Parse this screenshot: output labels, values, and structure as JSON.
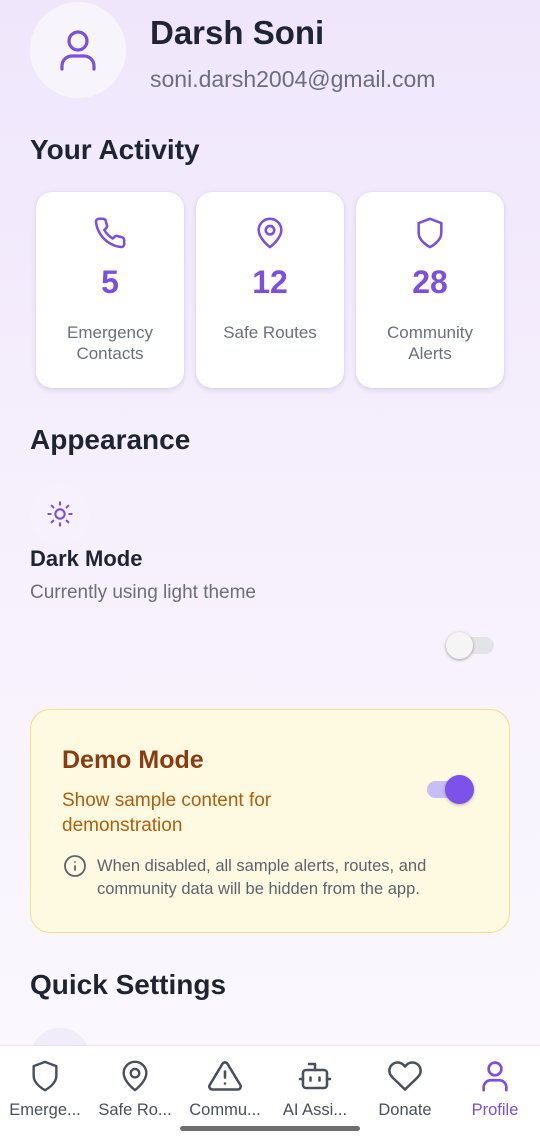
{
  "profile": {
    "name": "Darsh Soni",
    "email": "soni.darsh2004@gmail.com",
    "avatar_icon": "user-icon"
  },
  "activity": {
    "title": "Your Activity",
    "stats": [
      {
        "value": "5",
        "label": "Emergency Contacts",
        "icon": "phone-icon"
      },
      {
        "value": "12",
        "label": "Safe Routes",
        "icon": "map-pin-icon"
      },
      {
        "value": "28",
        "label": "Community Alerts",
        "icon": "shield-icon"
      }
    ]
  },
  "appearance": {
    "title": "Appearance",
    "dark_mode": {
      "label": "Dark Mode",
      "description": "Currently using light theme",
      "enabled": false,
      "icon": "sun-icon"
    }
  },
  "demo_mode": {
    "title": "Demo Mode",
    "description": "Show sample content for demonstration",
    "note": "When disabled, all sample alerts, routes, and community data will be hidden from the app.",
    "enabled": true,
    "icon": "info-icon"
  },
  "quick_settings": {
    "title": "Quick Settings"
  },
  "nav": {
    "items": [
      {
        "label": "Emerge...",
        "icon": "shield-icon",
        "active": false
      },
      {
        "label": "Safe Ro...",
        "icon": "map-pin-icon",
        "active": false
      },
      {
        "label": "Commu...",
        "icon": "alert-triangle-icon",
        "active": false
      },
      {
        "label": "AI Assi...",
        "icon": "bot-icon",
        "active": false
      },
      {
        "label": "Donate",
        "icon": "heart-icon",
        "active": false
      },
      {
        "label": "Profile",
        "icon": "user-icon",
        "active": true
      }
    ]
  },
  "colors": {
    "accent": "#7b4fe0",
    "demo_title": "#893c10",
    "demo_text": "#b25d08",
    "demo_bg": "#fefae2",
    "demo_border": "#f4de86"
  }
}
